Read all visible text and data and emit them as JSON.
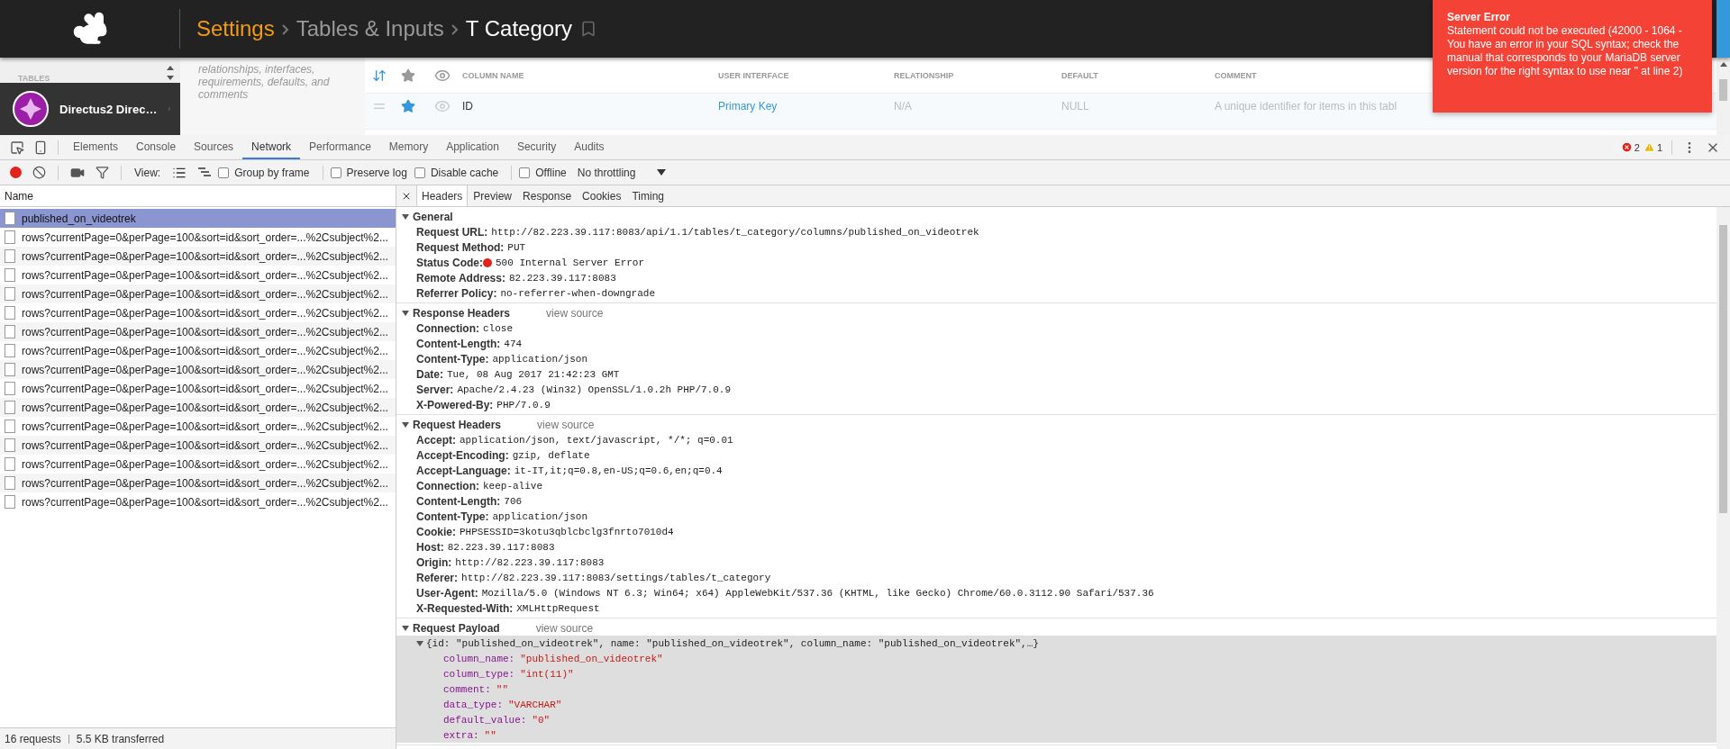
{
  "app": {
    "breadcrumb": [
      {
        "label": "Settings",
        "kind": "section"
      },
      {
        "label": "Tables & Inputs",
        "kind": "link"
      },
      {
        "label": "T Category",
        "kind": "current"
      }
    ],
    "sidebar": {
      "section_label": "TABLES",
      "project": "Directus2 Direc…"
    },
    "description": "relationships, interfaces, requirements, defaults, and comments",
    "table": {
      "columns": [
        "COLUMN NAME",
        "USER INTERFACE",
        "RELATIONSHIP",
        "DEFAULT",
        "COMMENT"
      ],
      "rows": [
        {
          "starred": true,
          "visible": false,
          "cells": [
            "ID",
            "Primary Key",
            "N/A",
            "NULL",
            "A unique identifier for items in this tabl"
          ]
        }
      ]
    },
    "toast": {
      "title": "Server Error",
      "message": "Statement could not be executed (42000 - 1064 - You have an error in your SQL syntax; check the manual that corresponds to your MariaDB server version for the right syntax to use near '' at line 2)"
    }
  },
  "devtools": {
    "tabs": [
      {
        "label": "Elements",
        "selected": false
      },
      {
        "label": "Console",
        "selected": false
      },
      {
        "label": "Sources",
        "selected": false
      },
      {
        "label": "Network",
        "selected": true
      },
      {
        "label": "Performance",
        "selected": false
      },
      {
        "label": "Memory",
        "selected": false
      },
      {
        "label": "Application",
        "selected": false
      },
      {
        "label": "Security",
        "selected": false
      },
      {
        "label": "Audits",
        "selected": false
      }
    ],
    "errors": "2",
    "warnings": "1",
    "toolbar": {
      "recording": true,
      "view_label": "View:",
      "options": [
        {
          "label": "Group by frame",
          "checked": false
        },
        {
          "label": "Preserve log",
          "checked": false
        },
        {
          "label": "Disable cache",
          "checked": false
        },
        {
          "label": "Offline",
          "checked": false
        }
      ],
      "throttling": "No throttling"
    },
    "requests": {
      "header": "Name",
      "items": [
        {
          "name": "published_on_videotrek",
          "selected": true
        },
        {
          "name": "rows?currentPage=0&perPage=100&sort=id&sort_order=...%2Csubject%2...",
          "selected": false
        },
        {
          "name": "rows?currentPage=0&perPage=100&sort=id&sort_order=...%2Csubject%2...",
          "selected": false
        },
        {
          "name": "rows?currentPage=0&perPage=100&sort=id&sort_order=...%2Csubject%2...",
          "selected": false
        },
        {
          "name": "rows?currentPage=0&perPage=100&sort=id&sort_order=...%2Csubject%2...",
          "selected": false
        },
        {
          "name": "rows?currentPage=0&perPage=100&sort=id&sort_order=...%2Csubject%2...",
          "selected": false
        },
        {
          "name": "rows?currentPage=0&perPage=100&sort=id&sort_order=...%2Csubject%2...",
          "selected": false
        },
        {
          "name": "rows?currentPage=0&perPage=100&sort=id&sort_order=...%2Csubject%2...",
          "selected": false
        },
        {
          "name": "rows?currentPage=0&perPage=100&sort=id&sort_order=...%2Csubject%2...",
          "selected": false
        },
        {
          "name": "rows?currentPage=0&perPage=100&sort=id&sort_order=...%2Csubject%2...",
          "selected": false
        },
        {
          "name": "rows?currentPage=0&perPage=100&sort=id&sort_order=...%2Csubject%2...",
          "selected": false
        },
        {
          "name": "rows?currentPage=0&perPage=100&sort=id&sort_order=...%2Csubject%2...",
          "selected": false
        },
        {
          "name": "rows?currentPage=0&perPage=100&sort=id&sort_order=...%2Csubject%2...",
          "selected": false
        },
        {
          "name": "rows?currentPage=0&perPage=100&sort=id&sort_order=...%2Csubject%2...",
          "selected": false
        },
        {
          "name": "rows?currentPage=0&perPage=100&sort=id&sort_order=...%2Csubject%2...",
          "selected": false
        },
        {
          "name": "rows?currentPage=0&perPage=100&sort=id&sort_order=...%2Csubject%2...",
          "selected": false
        }
      ],
      "count": "16 requests",
      "transferred": "5.5 KB transferred"
    },
    "detail": {
      "tabs": [
        {
          "label": "Headers",
          "selected": true
        },
        {
          "label": "Preview",
          "selected": false
        },
        {
          "label": "Response",
          "selected": false
        },
        {
          "label": "Cookies",
          "selected": false
        },
        {
          "label": "Timing",
          "selected": false
        }
      ],
      "sections": [
        {
          "kind": "headers",
          "title": "General",
          "expanded": true,
          "headers": [
            {
              "name": "Request URL:",
              "value": "http://82.223.39.117:8083/api/1.1/tables/t_category/columns/published_on_videotrek",
              "kind": "plain"
            },
            {
              "name": "Request Method:",
              "value": "PUT",
              "kind": "plain"
            },
            {
              "name": "Status Code:",
              "value": "500 Internal Server Error",
              "kind": "status"
            },
            {
              "name": "Remote Address:",
              "value": "82.223.39.117:8083",
              "kind": "plain"
            },
            {
              "name": "Referrer Policy:",
              "value": "no-referrer-when-downgrade",
              "kind": "plain"
            }
          ]
        },
        {
          "kind": "headers",
          "title": "Response Headers",
          "action": "view source",
          "expanded": true,
          "headers": [
            {
              "name": "Connection:",
              "value": "close",
              "kind": "plain"
            },
            {
              "name": "Content-Length:",
              "value": "474",
              "kind": "plain"
            },
            {
              "name": "Content-Type:",
              "value": "application/json",
              "kind": "plain"
            },
            {
              "name": "Date:",
              "value": "Tue, 08 Aug 2017 21:42:23 GMT",
              "kind": "plain"
            },
            {
              "name": "Server:",
              "value": "Apache/2.4.23 (Win32) OpenSSL/1.0.2h PHP/7.0.9",
              "kind": "plain"
            },
            {
              "name": "X-Powered-By:",
              "value": "PHP/7.0.9",
              "kind": "plain"
            }
          ]
        },
        {
          "kind": "headers",
          "title": "Request Headers",
          "action": "view source",
          "expanded": true,
          "headers": [
            {
              "name": "Accept:",
              "value": "application/json, text/javascript, */*; q=0.01",
              "kind": "plain"
            },
            {
              "name": "Accept-Encoding:",
              "value": "gzip, deflate",
              "kind": "plain"
            },
            {
              "name": "Accept-Language:",
              "value": "it-IT,it;q=0.8,en-US;q=0.6,en;q=0.4",
              "kind": "plain"
            },
            {
              "name": "Connection:",
              "value": "keep-alive",
              "kind": "plain"
            },
            {
              "name": "Content-Length:",
              "value": "706",
              "kind": "plain"
            },
            {
              "name": "Content-Type:",
              "value": "application/json",
              "kind": "plain"
            },
            {
              "name": "Cookie:",
              "value": "PHPSESSID=3kotu3qblcbclg3fnrto7010d4",
              "kind": "plain"
            },
            {
              "name": "Host:",
              "value": "82.223.39.117:8083",
              "kind": "plain"
            },
            {
              "name": "Origin:",
              "value": "http://82.223.39.117:8083",
              "kind": "plain"
            },
            {
              "name": "Referer:",
              "value": "http://82.223.39.117:8083/settings/tables/t_category",
              "kind": "plain"
            },
            {
              "name": "User-Agent:",
              "value": "Mozilla/5.0 (Windows NT 6.3; Win64; x64) AppleWebKit/537.36 (KHTML, like Gecko) Chrome/60.0.3112.90 Safari/537.36",
              "kind": "plain"
            },
            {
              "name": "X-Requested-With:",
              "value": "XMLHttpRequest",
              "kind": "plain"
            }
          ]
        },
        {
          "kind": "payload",
          "title": "Request Payload",
          "action": "view source",
          "expanded": true,
          "summary": "{id: \"published_on_videotrek\", name: \"published_on_videotrek\", column_name: \"published_on_videotrek\",…}",
          "summary_expanded": true,
          "fields": [
            {
              "key": "column_name:",
              "value": "\"published_on_videotrek\""
            },
            {
              "key": "column_type:",
              "value": "\"int(11)\""
            },
            {
              "key": "comment:",
              "value": "\"\""
            },
            {
              "key": "data_type:",
              "value": "\"VARCHAR\""
            },
            {
              "key": "default_value:",
              "value": "\"0\""
            },
            {
              "key": "extra:",
              "value": "\"\""
            }
          ]
        }
      ]
    }
  }
}
